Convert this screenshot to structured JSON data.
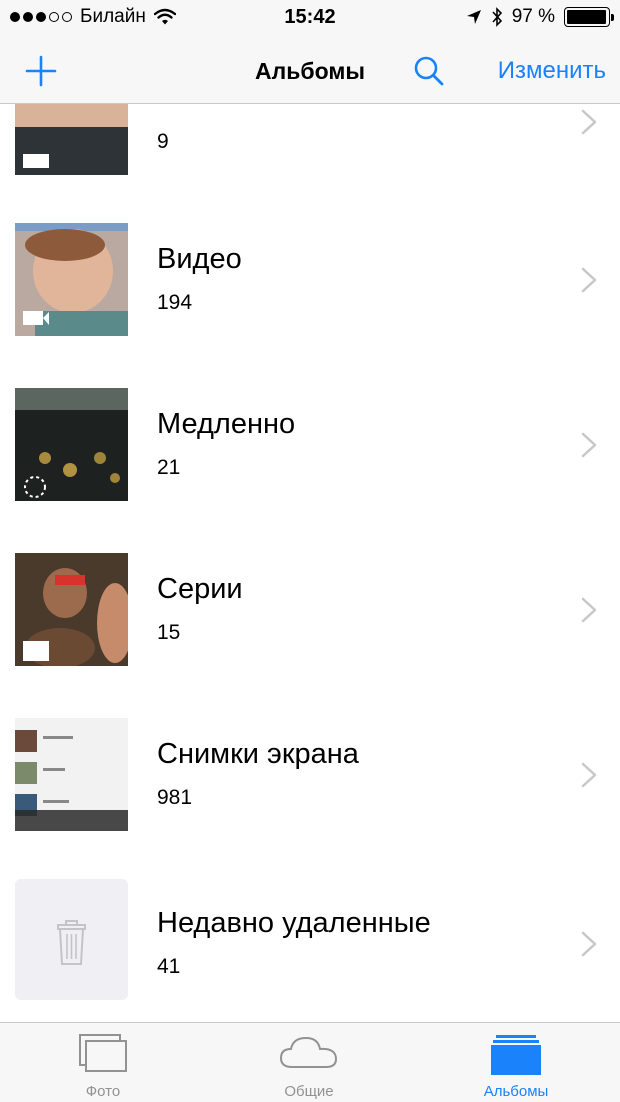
{
  "status_bar": {
    "carrier": "Билайн",
    "time": "15:42",
    "battery": "97 %",
    "battery_level": 0.97
  },
  "nav": {
    "title": "Альбомы",
    "edit_label": "Изменить",
    "accent_color": "#1a82fb"
  },
  "albums": [
    {
      "title": "",
      "count": "9",
      "icon": "panorama-badge-icon"
    },
    {
      "title": "Видео",
      "count": "194",
      "icon": "video-badge-icon"
    },
    {
      "title": "Медленно",
      "count": "21",
      "icon": "slo-mo-badge-icon"
    },
    {
      "title": "Серии",
      "count": "15",
      "icon": "burst-badge-icon"
    },
    {
      "title": "Снимки экрана",
      "count": "981",
      "icon": ""
    },
    {
      "title": "Недавно удаленные",
      "count": "41",
      "icon": "trash-icon"
    }
  ],
  "tabs": [
    {
      "label": "Фото",
      "icon": "photos-tab-icon",
      "active": false
    },
    {
      "label": "Общие",
      "icon": "cloud-tab-icon",
      "active": false
    },
    {
      "label": "Альбомы",
      "icon": "albums-tab-icon",
      "active": true
    }
  ]
}
